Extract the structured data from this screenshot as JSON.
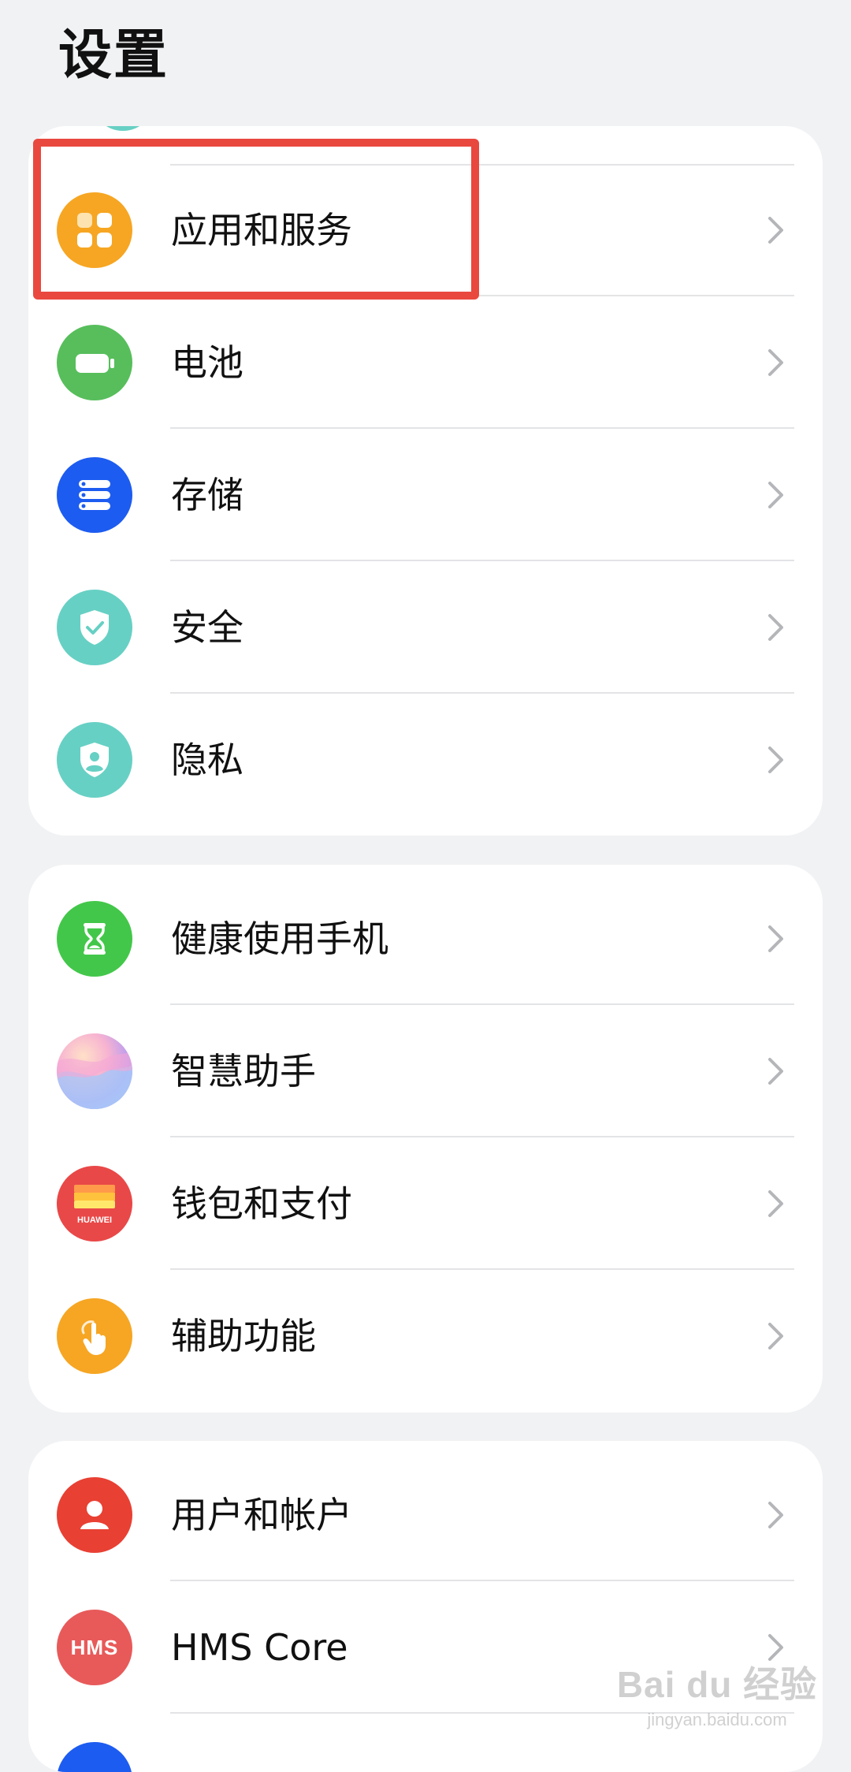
{
  "header": {
    "title": "设置"
  },
  "groups": [
    {
      "items": [
        {
          "label": "应用和服务",
          "icon": "apps-icon",
          "color": "#f6a623"
        },
        {
          "label": "电池",
          "icon": "battery-icon",
          "color": "#57be5b"
        },
        {
          "label": "存储",
          "icon": "storage-icon",
          "color": "#1d5cf0"
        },
        {
          "label": "安全",
          "icon": "security-shield-icon",
          "color": "#67d0c4"
        },
        {
          "label": "隐私",
          "icon": "privacy-shield-icon",
          "color": "#67d0c4"
        }
      ]
    },
    {
      "items": [
        {
          "label": "健康使用手机",
          "icon": "hourglass-icon",
          "color": "#43c74a"
        },
        {
          "label": "智慧助手",
          "icon": "assistant-icon",
          "color": "#c9a6ef"
        },
        {
          "label": "钱包和支付",
          "icon": "wallet-icon",
          "color": "#e94848",
          "icon_text": "HUAWEI"
        },
        {
          "label": "辅助功能",
          "icon": "accessibility-hand-icon",
          "color": "#f6a623"
        }
      ]
    },
    {
      "items": [
        {
          "label": "用户和帐户",
          "icon": "user-icon",
          "color": "#e84033"
        },
        {
          "label": "HMS Core",
          "icon": "hms-icon",
          "color": "#e85a5a",
          "icon_text": "HMS"
        }
      ]
    }
  ],
  "watermark": {
    "main": "Bai du 经验",
    "sub": "jingyan.baidu.com"
  },
  "colors": {
    "highlight": "#e9483f",
    "background": "#f1f2f4"
  }
}
